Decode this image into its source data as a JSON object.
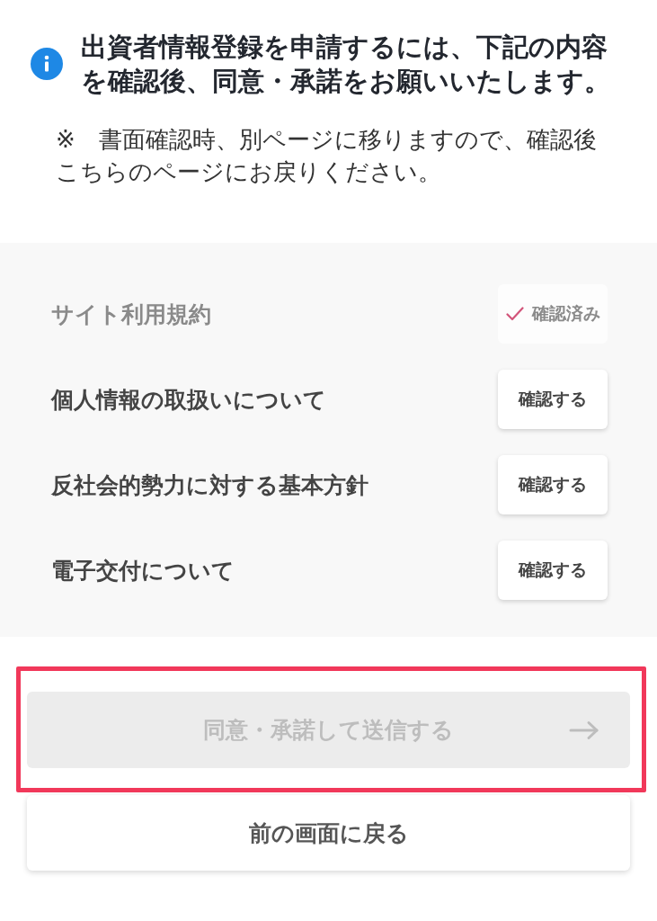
{
  "notice": {
    "title_lines": [
      "出資者情報登録を申請するには、下記の内容",
      "を確認後、同意・承諾をお願いいたします。"
    ],
    "note_lines": [
      "※　書面確認時、別ページに移りますので、確認後",
      "こちらのページにお戻りください。"
    ]
  },
  "documents": [
    {
      "label": "サイト利用規約",
      "confirmed": true,
      "action": "確認済み"
    },
    {
      "label": "個人情報の取扱いについて",
      "confirmed": false,
      "action": "確認する"
    },
    {
      "label": "反社会的勢力に対する基本方針",
      "confirmed": false,
      "action": "確認する"
    },
    {
      "label": "電子交付について",
      "confirmed": false,
      "action": "確認する"
    }
  ],
  "submit_button": {
    "label": "同意・承諾して送信する",
    "disabled": true,
    "highlighted": true
  },
  "back_button": {
    "label": "前の画面に戻る"
  }
}
